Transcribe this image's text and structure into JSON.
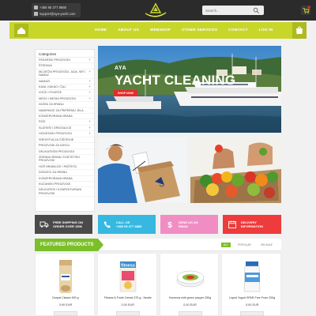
{
  "header": {
    "phone": "+385 95 377 8888",
    "email": "support@aya-yacht.com",
    "search_placeholder": "Search..."
  },
  "nav": {
    "items": [
      "HOME",
      "ABOUT US",
      "WEBSHOP",
      "OTHER SERVICES",
      "CONTACT",
      "LOG IN"
    ],
    "accent_color": "#c8d62a"
  },
  "sidebar": {
    "title": "Categories",
    "items": [
      {
        "label": "Pekarski proizvodi",
        "plus": true
      },
      {
        "label": "Štednja",
        "plus": false
      },
      {
        "label": "Mliječni proizvodi, jaja, sir i namaz",
        "plus": true
      },
      {
        "label": "Namazi",
        "plus": true
      },
      {
        "label": "Kava, kakao i čaj",
        "plus": true
      },
      {
        "label": "Voće i povrće",
        "plus": true
      },
      {
        "label": "Meso i mesni proizvodi",
        "plus": true
      },
      {
        "label": "Začini za hranu",
        "plus": false
      },
      {
        "label": "Namirnice za pripremu jela",
        "plus": false
      },
      {
        "label": "Konzervirana hrana",
        "plus": false
      },
      {
        "label": "Piće",
        "plus": true
      },
      {
        "label": "Slatkiši i grickalice",
        "plus": true
      },
      {
        "label": "Higijenski proizvodi",
        "plus": true
      },
      {
        "label": "Sredstva za čišćenje",
        "plus": false
      },
      {
        "label": "Proizvodi za djecu",
        "plus": false
      },
      {
        "label": "Delikatesni proizvodi",
        "plus": false
      },
      {
        "label": "Zdrava hrana i dijetetski proizvodi",
        "plus": false
      },
      {
        "label": "Hoš hranilice i pašteta",
        "plus": false
      },
      {
        "label": "Dodatci za hranu",
        "plus": false
      },
      {
        "label": "Konzervirana hrana",
        "plus": false
      },
      {
        "label": "Kućanski proizvodi",
        "plus": false
      },
      {
        "label": "Delikatesi i konfektuirani proizvodi",
        "plus": false
      }
    ]
  },
  "hero": {
    "subtitle": "AYA",
    "title": "YACHT CLEANING",
    "button": "SHOP NOW"
  },
  "features": [
    {
      "text": "Free shipping on\norder over 150€",
      "icon": "truck-icon",
      "color": "#4a4a4a"
    },
    {
      "text": "Call us\n+385 95 377 8888",
      "icon": "phone-icon",
      "color": "#36b8e0"
    },
    {
      "text": "Send us an\nemail",
      "icon": "dollar-icon",
      "color": "#f08ec4"
    },
    {
      "text": "Delivery\ninformation",
      "icon": "calendar-icon",
      "color": "#ee3b3b"
    }
  ],
  "featured": {
    "title": "FEATURED PRODUCTS",
    "tabs": [
      "ALL",
      "POPULAR",
      "ON SALE"
    ],
    "active_tab": "ALL",
    "products": [
      {
        "name": "Dorpat Classic 500 g",
        "price": "0,90 EUR"
      },
      {
        "name": "Fitness & Fruits Cereal 375 g - Nestle",
        "price": "0,00 EUR"
      },
      {
        "name": "Hummus with green pepper 250g",
        "price": "0,00 EUR"
      },
      {
        "name": "Liquid Yogurt SPAR Free From 200g",
        "price": "0,00 EUR"
      }
    ]
  }
}
